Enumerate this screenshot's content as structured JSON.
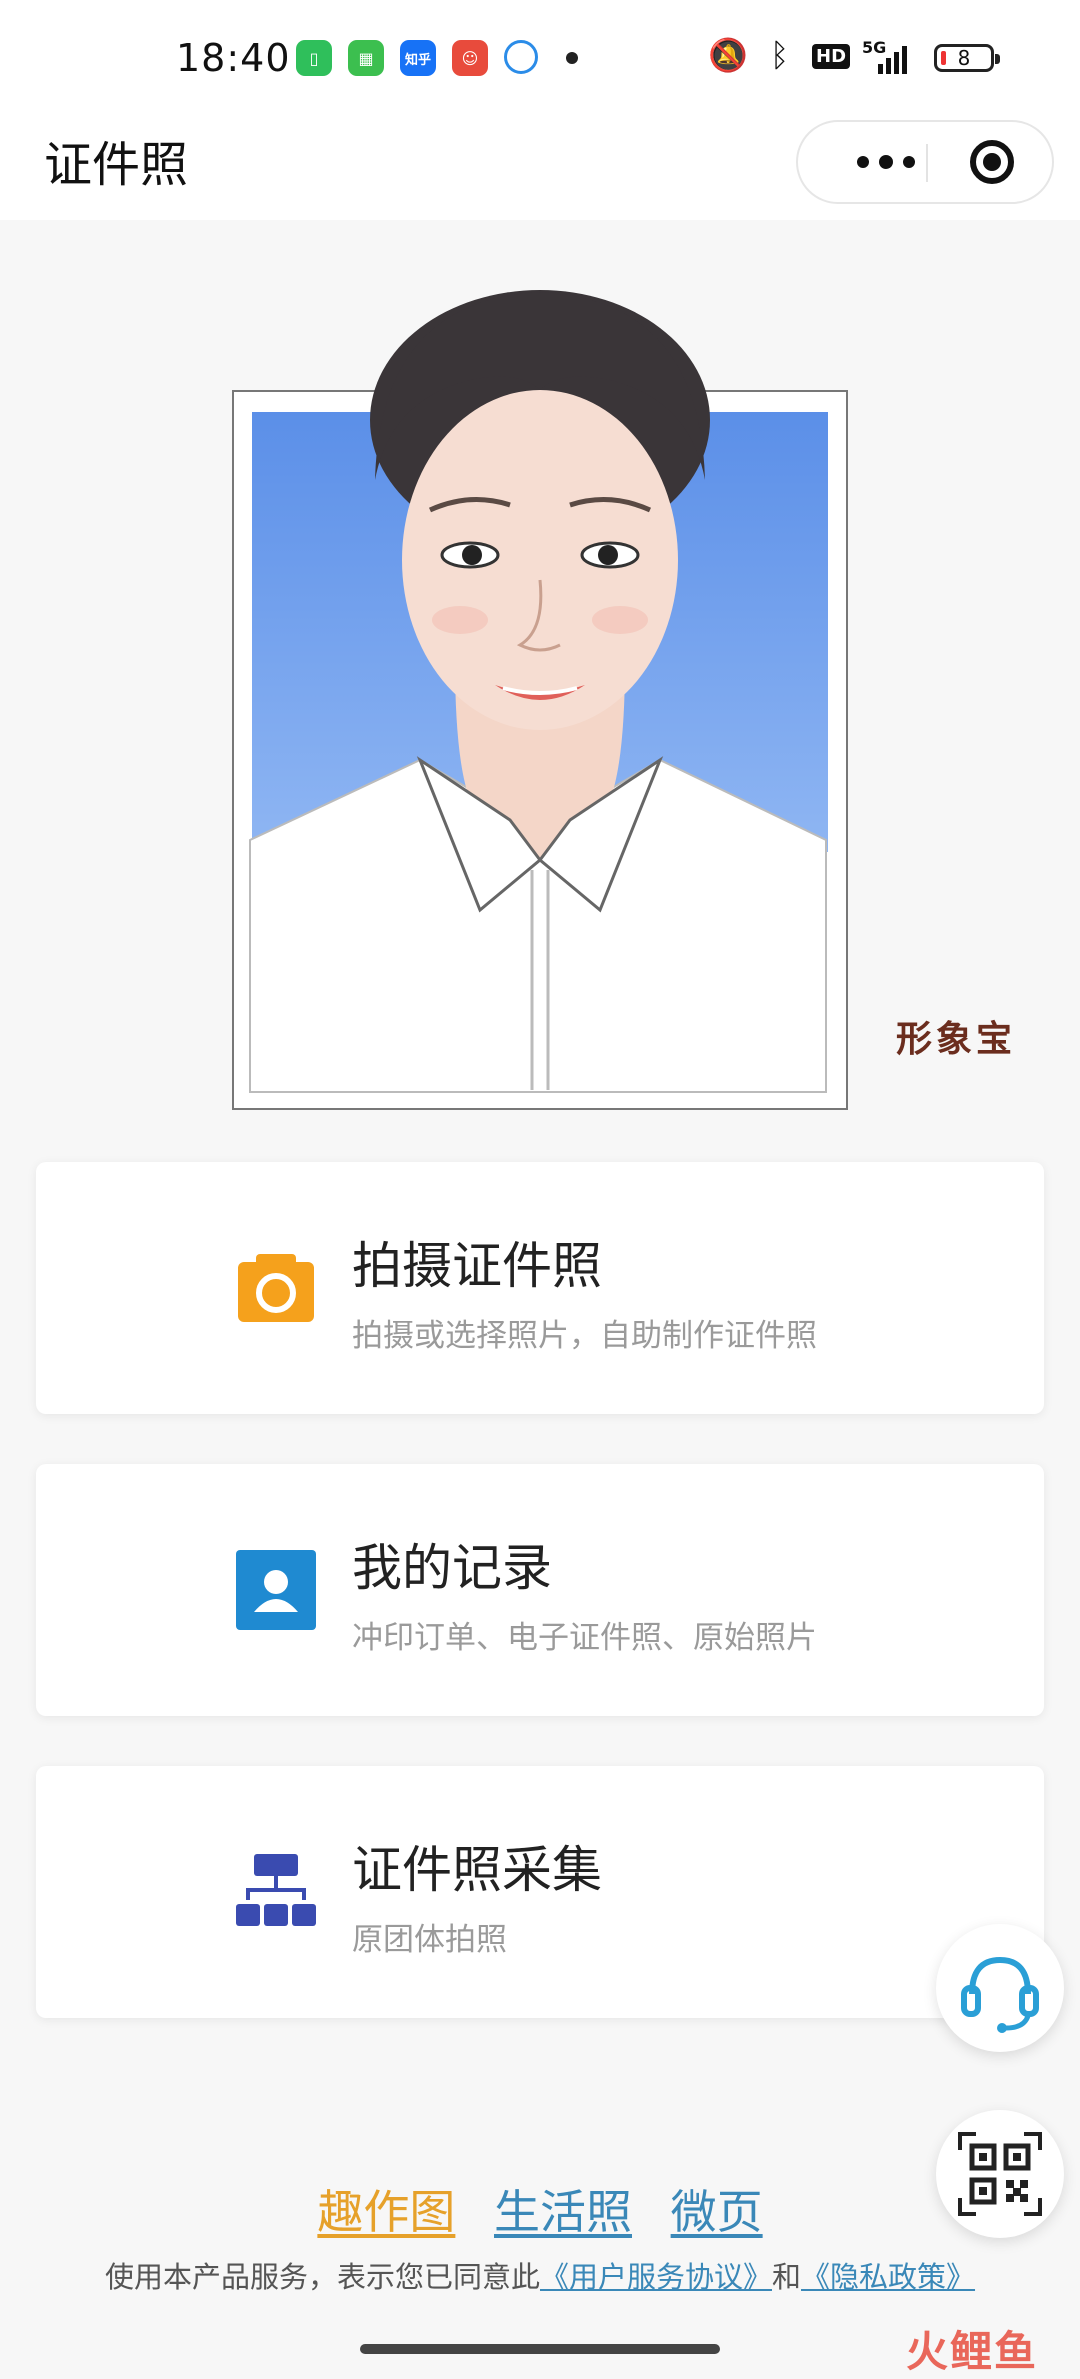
{
  "status_bar": {
    "time": "18:40",
    "notification_icons": [
      "battery-app-icon",
      "shopping-app-icon",
      "zhihu-app-icon",
      "app-icon",
      "browser-app-icon"
    ],
    "zhihu_label": "知乎",
    "hd_label": "HD",
    "network_label": "5G",
    "battery_level": "8"
  },
  "nav": {
    "title": "证件照"
  },
  "hero": {
    "brand_label": "形象宝"
  },
  "cards": [
    {
      "title": "拍摄证件照",
      "subtitle": "拍摄或选择照片，自助制作证件照",
      "icon": "camera-icon",
      "color": "#f5a11c"
    },
    {
      "title": "我的记录",
      "subtitle": "冲印订单、电子证件照、原始照片",
      "icon": "user-icon",
      "color": "#1f8ad1"
    },
    {
      "title": "证件照采集",
      "subtitle": "原团体拍照",
      "icon": "org-chart-icon",
      "color": "#3a4bb0"
    }
  ],
  "footer": {
    "links": [
      {
        "label": "趣作图",
        "color": "#e6a12a"
      },
      {
        "label": "生活照",
        "color": "#3a88b8"
      },
      {
        "label": "微页",
        "color": "#3a88b8"
      }
    ],
    "agreement_prefix": "使用本产品服务，表示您已同意此",
    "terms_link": "《用户服务协议》",
    "agreement_and": "和",
    "privacy_link": "《隐私政策》"
  },
  "watermark": "火鲤鱼",
  "colors": {
    "accent_orange": "#f5a11c",
    "accent_blue": "#1f8ad1",
    "accent_indigo": "#3a4bb0",
    "support_teal": "#2a9fd6"
  }
}
